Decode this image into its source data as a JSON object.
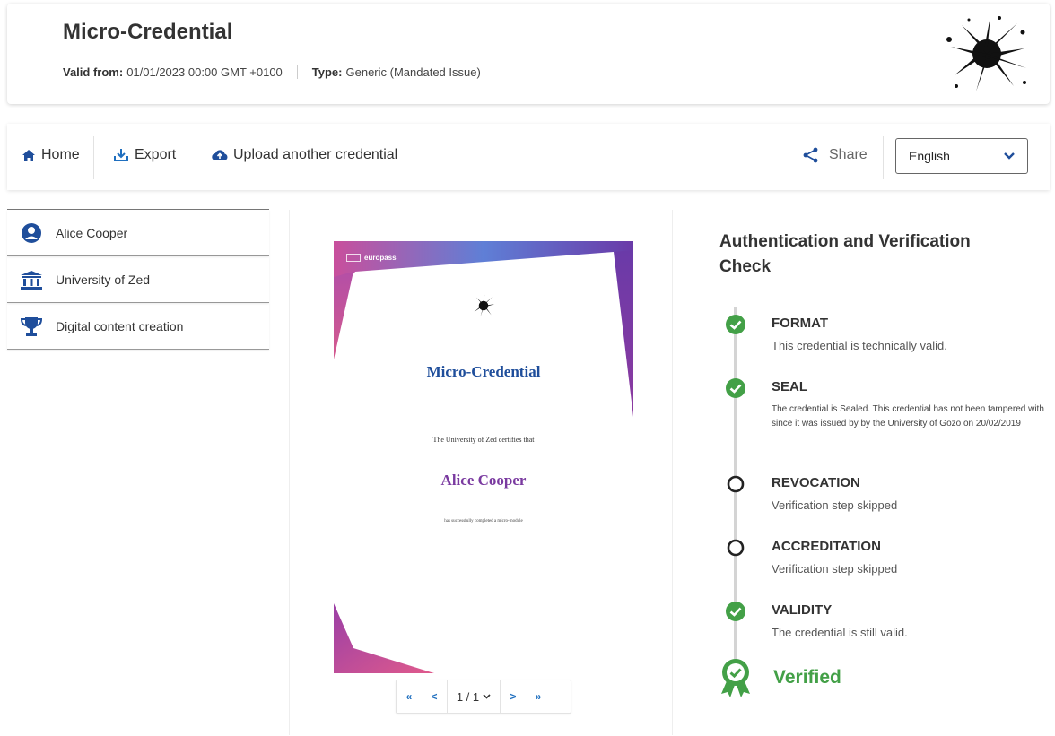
{
  "header": {
    "title": "Micro-Credential",
    "valid_from_label": "Valid from:",
    "valid_from_value": "01/01/2023 00:00 GMT +0100",
    "type_label": "Type:",
    "type_value": "Generic (Mandated Issue)",
    "logo_icon": "ink-splat-logo"
  },
  "toolbar": {
    "home_label": "Home",
    "export_label": "Export",
    "upload_label": "Upload another credential",
    "share_label": "Share",
    "language_value": "English"
  },
  "sidebar": {
    "items": [
      {
        "label": "Alice Cooper",
        "icon": "user-circle-icon"
      },
      {
        "label": "University of Zed",
        "icon": "institution-icon"
      },
      {
        "label": "Digital content creation",
        "icon": "trophy-icon"
      }
    ]
  },
  "preview": {
    "brand": "europass",
    "title": "Micro-Credential",
    "certifies_text": "The University of Zed certifies that",
    "holder_name": "Alice Cooper",
    "completed_text": "has successfully completed a micro-module",
    "pager": {
      "first": "«",
      "prev": "<",
      "page": "1 / 1",
      "next": ">",
      "last": "»"
    }
  },
  "verification": {
    "title": "Authentication and Verification Check",
    "steps": [
      {
        "title": "FORMAT",
        "desc": "This credential is technically valid.",
        "status": "ok"
      },
      {
        "title": "SEAL",
        "desc": "The credential is Sealed. This credential has not been tampered with since it was issued by by the University of Gozo on 20/02/2019",
        "status": "ok"
      },
      {
        "title": "REVOCATION",
        "desc": "Verification step skipped",
        "status": "skipped"
      },
      {
        "title": "ACCREDITATION",
        "desc": "Verification step skipped",
        "status": "skipped"
      },
      {
        "title": "VALIDITY",
        "desc": "The credential is still valid.",
        "status": "ok"
      }
    ],
    "result": "Verified"
  },
  "colors": {
    "accent_blue": "#1f4e9b",
    "success_green": "#43a047",
    "holder_purple": "#7a3aa0"
  }
}
